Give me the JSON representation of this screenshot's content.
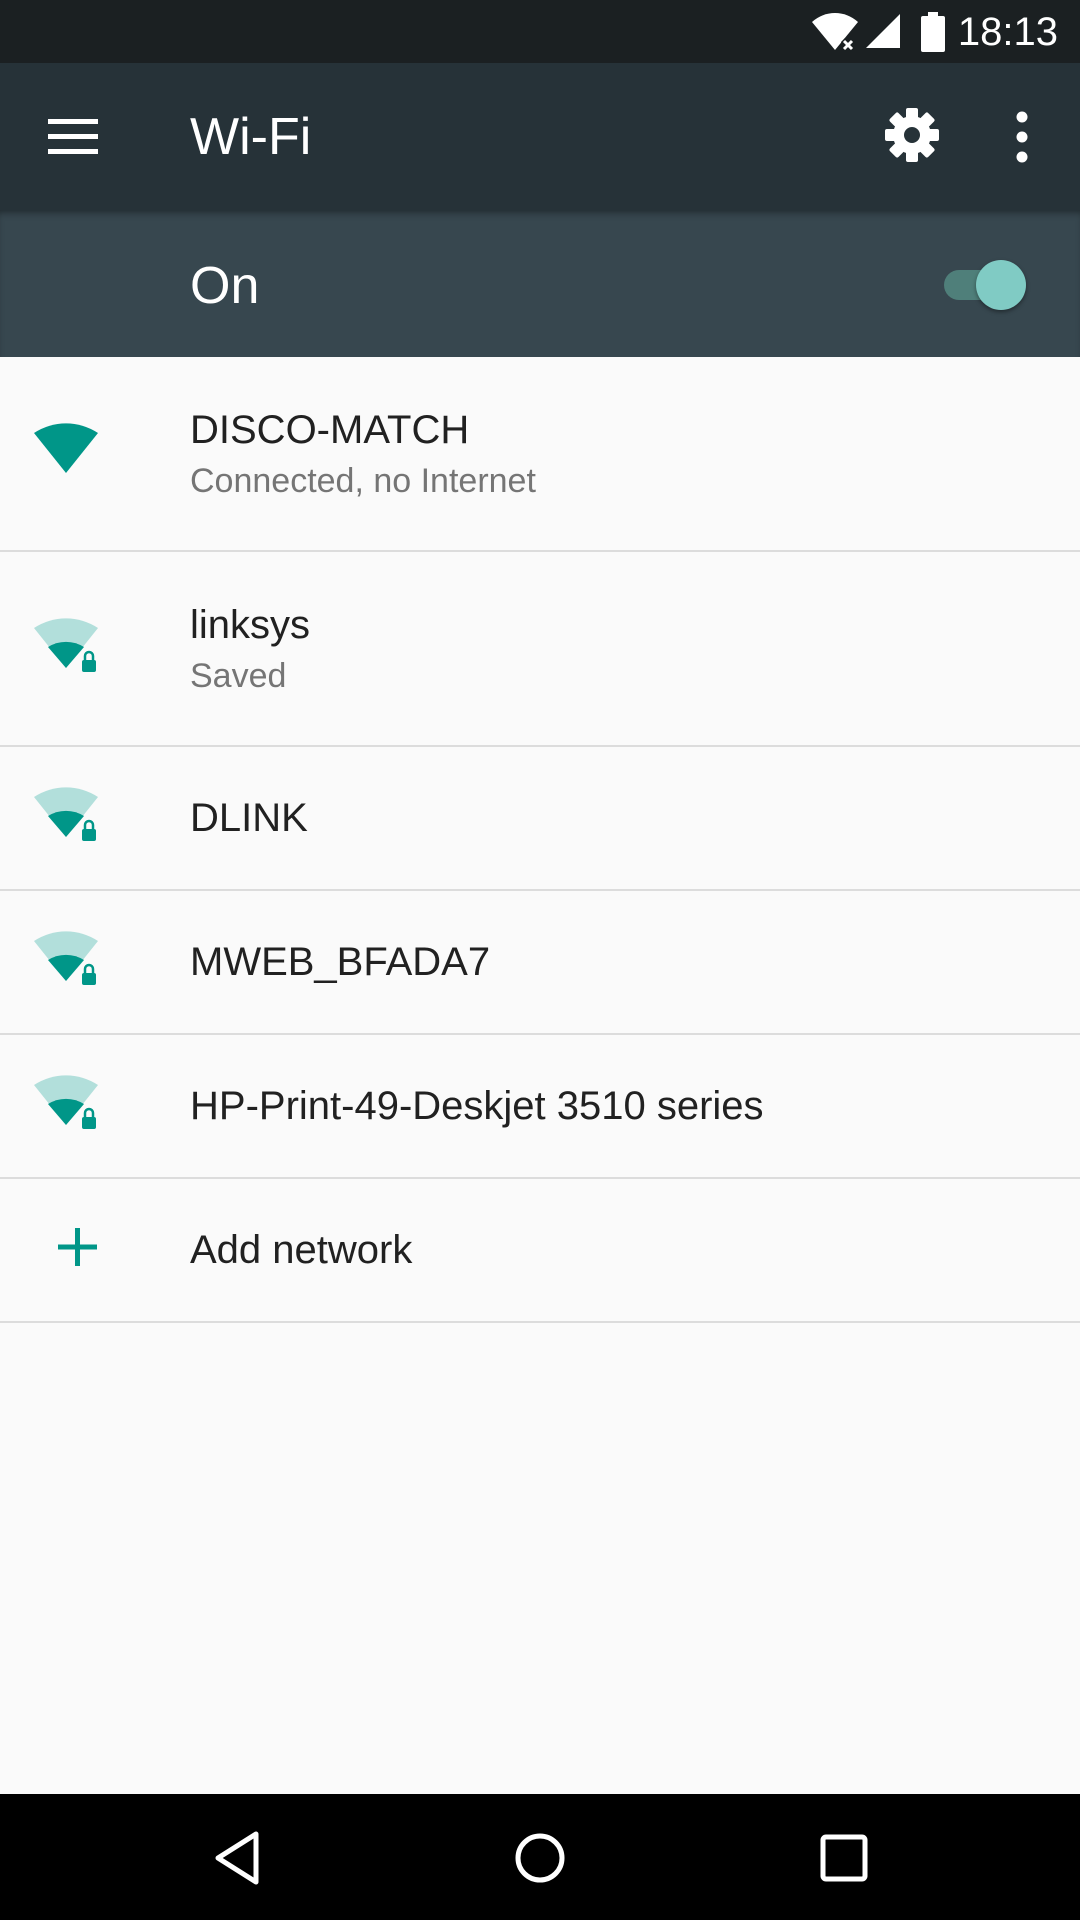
{
  "status_bar": {
    "time": "18:13"
  },
  "app_bar": {
    "title": "Wi-Fi"
  },
  "master_switch": {
    "label": "On",
    "state": "on"
  },
  "networks": [
    {
      "name": "DISCO-MATCH",
      "status": "Connected, no Internet",
      "secured": false,
      "signal": "full"
    },
    {
      "name": "linksys",
      "status": "Saved",
      "secured": true,
      "signal": "medium"
    },
    {
      "name": "DLINK",
      "status": "",
      "secured": true,
      "signal": "medium"
    },
    {
      "name": "MWEB_BFADA7",
      "status": "",
      "secured": true,
      "signal": "medium"
    },
    {
      "name": "HP-Print-49-Deskjet 3510 series",
      "status": "",
      "secured": true,
      "signal": "medium"
    }
  ],
  "add_network": {
    "label": "Add network"
  },
  "icons": {
    "menu": "menu-icon",
    "settings": "gear-icon",
    "overflow": "more-vert-icon",
    "add": "plus-icon",
    "back": "back-icon",
    "home": "home-icon",
    "recents": "recents-icon"
  },
  "colors": {
    "accent": "#009688",
    "accent_light": "#80cbc4",
    "app_bar": "#263238",
    "switch_bar": "#37474f"
  }
}
